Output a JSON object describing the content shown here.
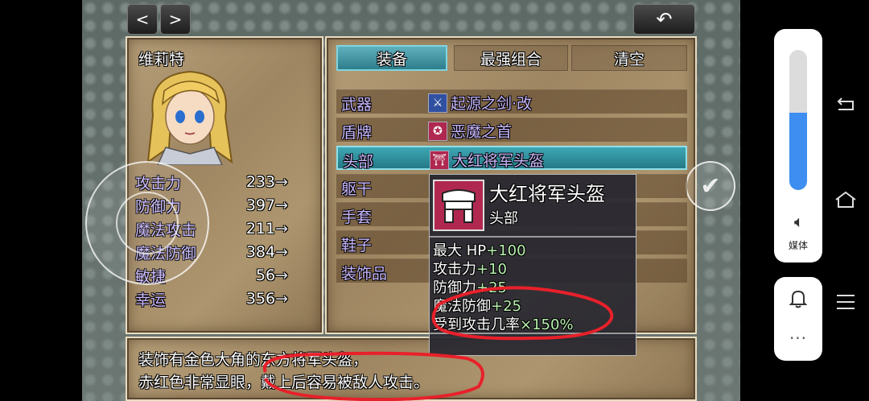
{
  "nav": {
    "prev": "<",
    "next": ">",
    "back": "↶"
  },
  "character": {
    "name": "维莉特"
  },
  "stats": [
    {
      "label": "攻击力",
      "value": "233"
    },
    {
      "label": "防御力",
      "value": "397"
    },
    {
      "label": "魔法攻击",
      "value": "211"
    },
    {
      "label": "魔法防御",
      "value": "384"
    },
    {
      "label": "敏捷",
      "value": "56"
    },
    {
      "label": "幸运",
      "value": "356"
    }
  ],
  "stat_arrow": "→",
  "tabs": [
    "装备",
    "最强组合",
    "清空"
  ],
  "slots": [
    {
      "label": "武器",
      "item": "起源之剑·改",
      "icon": "sword-icon"
    },
    {
      "label": "盾牌",
      "item": "恶魔之首",
      "icon": "demon-shield-icon"
    },
    {
      "label": "头部",
      "item": "大红将军头盔",
      "icon": "helmet-icon"
    },
    {
      "label": "躯干",
      "item": ""
    },
    {
      "label": "手套",
      "item": ""
    },
    {
      "label": "鞋子",
      "item": ""
    },
    {
      "label": "装饰品",
      "item": ""
    }
  ],
  "popup": {
    "name": "大红将军头盔",
    "type": "头部",
    "effects": [
      {
        "label": "最大 HP",
        "value": "+100"
      },
      {
        "label": "攻击力",
        "value": "+10"
      },
      {
        "label": "防御力",
        "value": "+25"
      },
      {
        "label": "魔法防御",
        "value": "+25"
      },
      {
        "label": "受到攻击几率",
        "value": "×150%"
      }
    ]
  },
  "description": {
    "line1": "装饰有金色大角的东方将军头盔，",
    "line2": "赤红色非常显眼，戴上后容易被敌人攻击。"
  },
  "system": {
    "media_label": "媒体",
    "volume_level": 0.55
  },
  "colors": {
    "accent": "#3fa7b4",
    "annotation": "#e8202a"
  }
}
